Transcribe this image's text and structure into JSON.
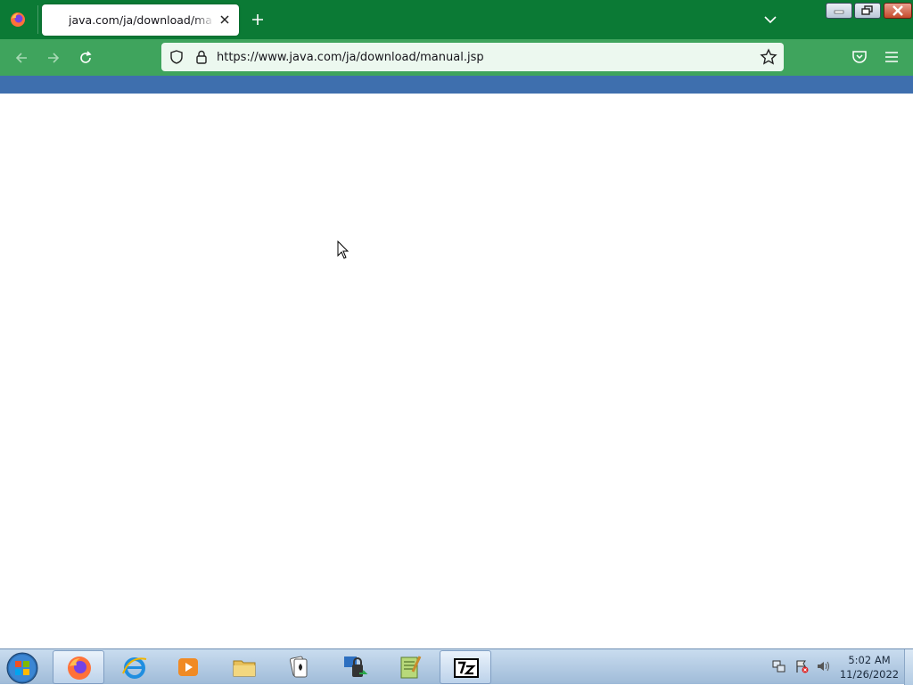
{
  "browser": {
    "tab": {
      "title": "java.com/ja/download/manual.jsp"
    },
    "url": "https://www.java.com/ja/download/manual.jsp"
  },
  "colors": {
    "tabstrip": "#0b7a35",
    "navbar": "#3fa45d",
    "page_header_bar": "#3e6fae"
  },
  "taskbar": {
    "items": [
      {
        "name": "firefox",
        "active": true
      },
      {
        "name": "internet-explorer",
        "active": false
      },
      {
        "name": "media-player",
        "active": false
      },
      {
        "name": "file-explorer",
        "active": false
      },
      {
        "name": "solitaire",
        "active": false
      },
      {
        "name": "network-lock-app",
        "active": false
      },
      {
        "name": "notepad-plus",
        "active": false
      },
      {
        "name": "7zip",
        "active": true
      }
    ],
    "clock": {
      "time": "5:02 AM",
      "date": "11/26/2022"
    }
  }
}
